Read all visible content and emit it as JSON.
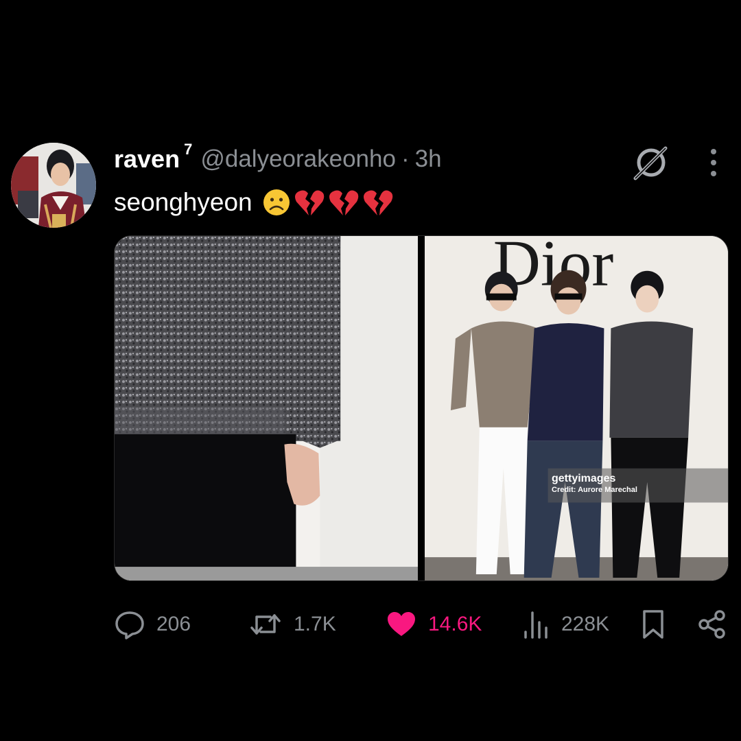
{
  "tweet": {
    "author": {
      "display_name": "raven",
      "superscript": "7",
      "handle": "@dalyeorakeonho"
    },
    "separator": "·",
    "timestamp": "3h",
    "text": "seonghyeon",
    "emoji_sequence": [
      "frowning-face",
      "broken-heart",
      "broken-heart",
      "broken-heart"
    ],
    "media": {
      "count": 2,
      "right_image": {
        "sign_text": "Dior",
        "watermark_brand": "gettyimages",
        "watermark_credit": "Credit: Aurore Marechal"
      }
    },
    "actions": {
      "replies": "206",
      "reposts": "1.7K",
      "likes": "14.6K",
      "views": "228K",
      "liked": true
    }
  },
  "icons": {
    "grok": "grok-icon",
    "more": "more-vertical-icon",
    "reply": "reply-icon",
    "repost": "repost-icon",
    "like": "heart-icon",
    "views": "views-icon",
    "bookmark": "bookmark-icon",
    "share": "share-icon"
  },
  "colors": {
    "background": "#000000",
    "text_primary": "#ffffff",
    "text_secondary": "#8b8f94",
    "like_accent": "#f91880",
    "broken_heart": "#e5323f",
    "emoji_face": "#f7c634"
  }
}
